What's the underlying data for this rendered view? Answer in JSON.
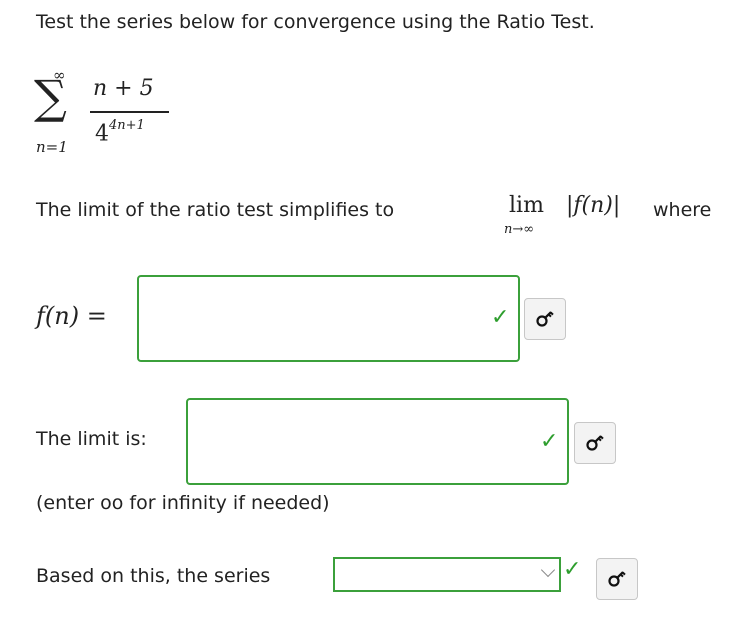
{
  "question": {
    "prompt": "Test the series below for convergence using the Ratio Test.",
    "series": {
      "sigma": "∑",
      "upper": "∞",
      "lower": "n=1",
      "numerator": "n + 5",
      "denominator_base": "4",
      "denominator_exp": "4n+1"
    },
    "limit_sentence": {
      "before": "The limit of the ratio test simplifies to",
      "lim": "lim",
      "lim_sub": "n→∞",
      "abs_expr": "|f(n)|",
      "after": "where"
    }
  },
  "fn_field": {
    "label": "f(n) =",
    "value": ""
  },
  "limit_field": {
    "label": "The limit is:",
    "value": "",
    "hint": "(enter oo for infinity if needed)"
  },
  "series_select": {
    "label": "Based on this, the series",
    "selected": ""
  },
  "icons": {
    "check": "check-icon",
    "key": "key-icon"
  },
  "colors": {
    "correct_green": "#3ba03b"
  }
}
